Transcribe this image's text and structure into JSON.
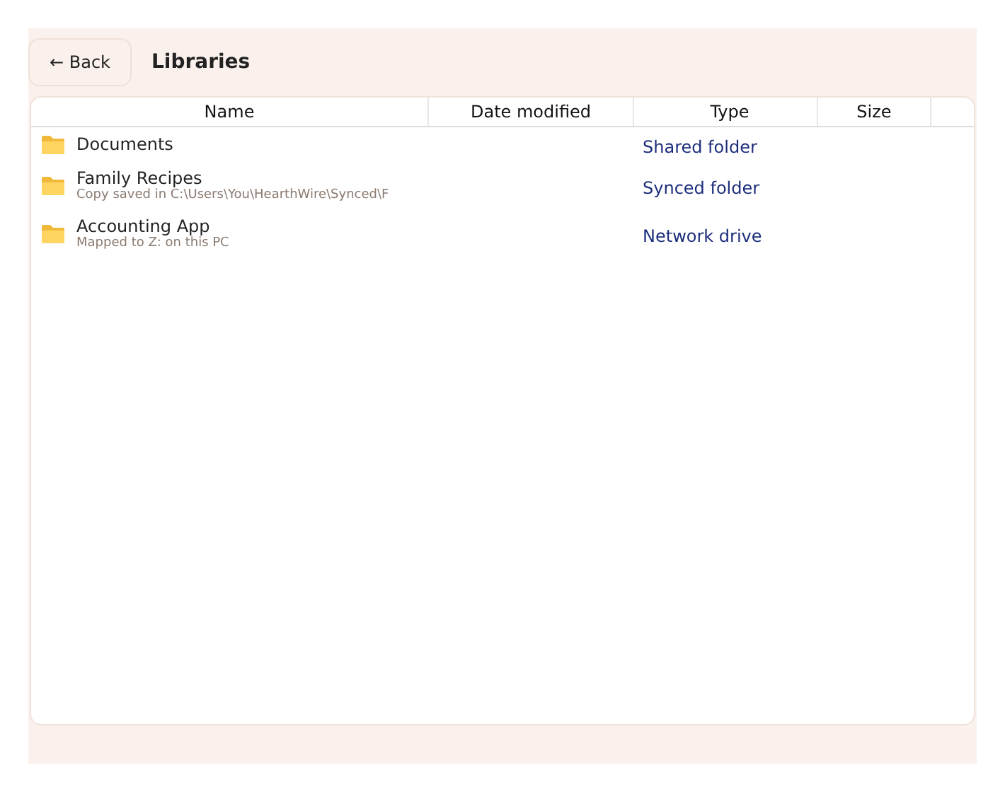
{
  "header": {
    "back_button": "← Back",
    "title": "Libraries"
  },
  "table": {
    "columns": [
      "Name",
      "Date modified",
      "Type",
      "Size"
    ],
    "rows": [
      {
        "name": "Documents",
        "type": "Shared folder"
      },
      {
        "name": "Family Recipes",
        "detail": "Copy saved in C:\\Users\\You\\HearthWire\\Synced\\F",
        "type": "Synced folder"
      },
      {
        "name": "Accounting App",
        "detail": "Mapped to Z: on this PC",
        "type": "Network drive"
      }
    ]
  }
}
